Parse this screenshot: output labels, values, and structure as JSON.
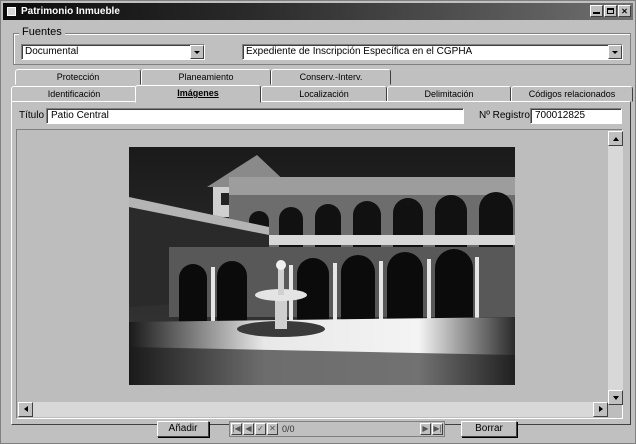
{
  "window": {
    "title": "Patrimonio Inmueble"
  },
  "fuentes": {
    "legend": "Fuentes",
    "category_value": "Documental",
    "source_value": "Expediente de Inscripción Específica en el CGPHA"
  },
  "tabs_back": [
    {
      "label": "Protección"
    },
    {
      "label": "Planeamiento"
    },
    {
      "label": "Conserv.-Interv."
    }
  ],
  "tabs_front": [
    {
      "label": "Identificación"
    },
    {
      "label": "Imágenes",
      "active": true
    },
    {
      "label": "Localización"
    },
    {
      "label": "Delimitación"
    },
    {
      "label": "Códigos relacionados"
    }
  ],
  "image_panel": {
    "title_label": "Título",
    "title_value": "Patio Central",
    "registro_label": "Nº Registro",
    "registro_value": "700012825"
  },
  "footer": {
    "add_label": "Añadir",
    "delete_label": "Borrar",
    "nav_first": "|◀",
    "nav_prev": "◀",
    "nav_ok": "✓",
    "nav_cancel": "✕",
    "record_count": "0/0",
    "nav_next": "▶",
    "nav_last": "▶|"
  },
  "icons": {
    "app": "app-icon",
    "minimize": "minimize-icon",
    "maximize": "maximize-icon",
    "close": "close-icon"
  }
}
